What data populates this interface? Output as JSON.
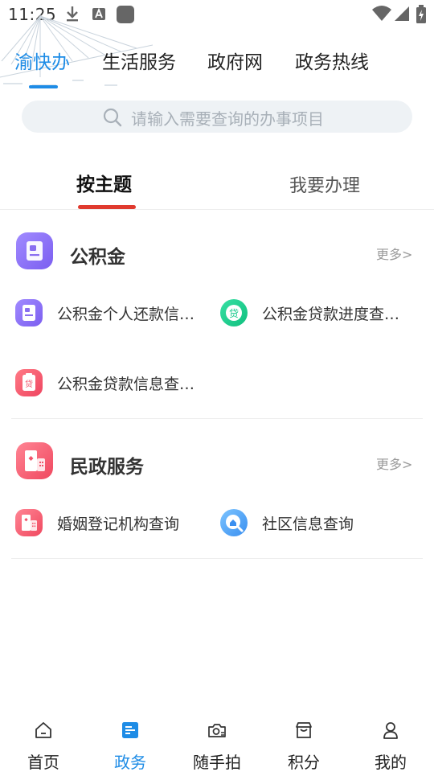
{
  "status_bar": {
    "time": "11:25"
  },
  "top_nav": {
    "tabs": [
      {
        "label": "渝快办",
        "active": true
      },
      {
        "label": "生活服务",
        "active": false
      },
      {
        "label": "政府网",
        "active": false
      },
      {
        "label": "政务热线",
        "active": false
      }
    ]
  },
  "search": {
    "placeholder": "请输入需要查询的办事项目"
  },
  "sub_tabs": [
    {
      "label": "按主题",
      "active": true
    },
    {
      "label": "我要办理",
      "active": false
    }
  ],
  "sections": [
    {
      "title": "公积金",
      "more_label": "更多>",
      "items": [
        {
          "label": "公积金个人还款信…",
          "icon": "id-card-icon"
        },
        {
          "label": "公积金贷款进度查…",
          "icon": "loan-icon",
          "icon_text": "贷"
        },
        {
          "label": "公积金贷款信息查…",
          "icon": "loan-document-icon",
          "icon_text": "贷"
        }
      ]
    },
    {
      "title": "民政服务",
      "more_label": "更多>",
      "items": [
        {
          "label": "婚姻登记机构查询",
          "icon": "building-icon"
        },
        {
          "label": "社区信息查询",
          "icon": "community-search-icon"
        }
      ]
    }
  ],
  "bottom_nav": [
    {
      "label": "首页",
      "icon": "home-icon",
      "active": false
    },
    {
      "label": "政务",
      "icon": "government-affairs-icon",
      "active": true
    },
    {
      "label": "随手拍",
      "icon": "camera-icon",
      "active": false
    },
    {
      "label": "积分",
      "icon": "points-store-icon",
      "active": false
    },
    {
      "label": "我的",
      "icon": "user-icon",
      "active": false
    }
  ],
  "colors": {
    "accent_blue": "#1e8ce6",
    "indicator_red": "#e03a2e",
    "search_bg": "#eef2f5",
    "purple_icon": "#8a6ff0",
    "green_icon": "#12c98a",
    "red_icon": "#f2526a"
  }
}
